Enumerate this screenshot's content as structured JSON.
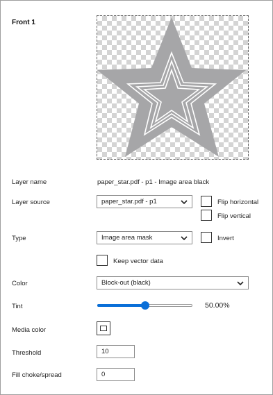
{
  "title": "Front 1",
  "preview": {
    "star_fill": "#a6a6a8",
    "outline": "#ffffff"
  },
  "layer_name": {
    "label": "Layer name",
    "value": "paper_star.pdf - p1 - Image area black"
  },
  "layer_source": {
    "label": "Layer source",
    "selected": "paper_star.pdf - p1",
    "flip_horizontal": "Flip horizontal",
    "flip_vertical": "Flip vertical"
  },
  "type": {
    "label": "Type",
    "selected": "Image area mask",
    "invert": "Invert",
    "keep_vector": "Keep vector data"
  },
  "color": {
    "label": "Color",
    "selected": "Block-out (black)"
  },
  "tint": {
    "label": "Tint",
    "value_text": "50.00%",
    "fraction": 0.5,
    "accent": "#0a6fd8"
  },
  "media_color": {
    "label": "Media color"
  },
  "threshold": {
    "label": "Threshold",
    "value": "10"
  },
  "fill_choke": {
    "label": "Fill choke/spread",
    "value": "0"
  }
}
